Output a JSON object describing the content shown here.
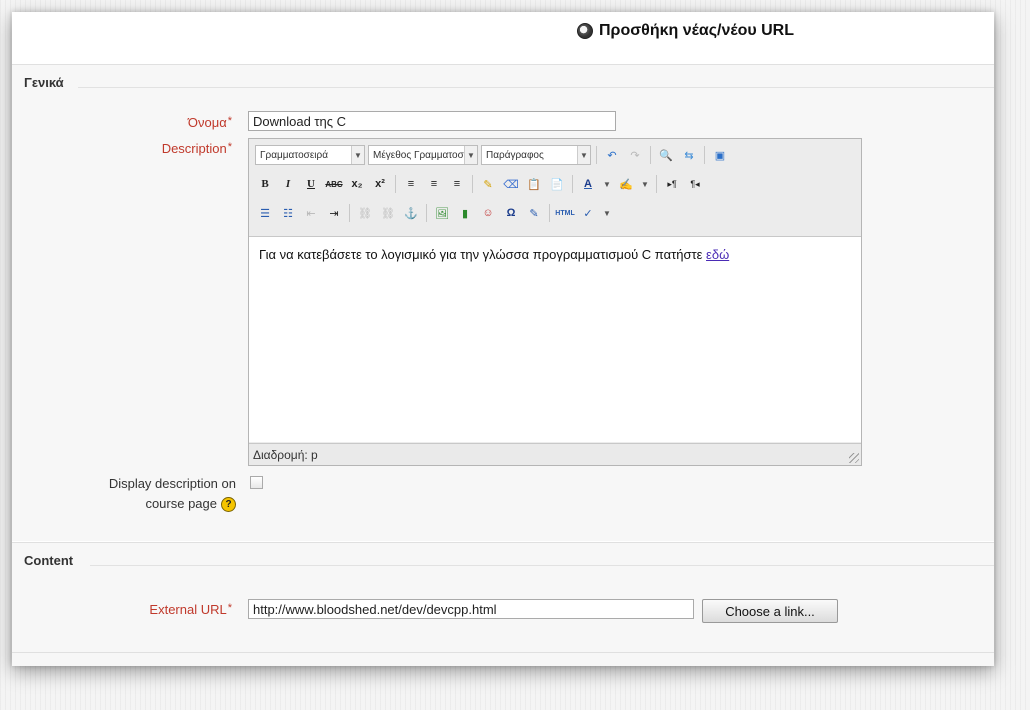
{
  "page": {
    "title": "Προσθήκη νέας/νέου URL",
    "title_icon": "url-resource-icon"
  },
  "general": {
    "legend": "Γενικά",
    "name_label": "Όνομα",
    "name_value": "Download της C",
    "description_label": "Description",
    "required_marker": "*",
    "editor": {
      "font_family": "Γραμματοσειρά",
      "font_size": "Μέγεθος Γραμματοσειράς",
      "paragraph": "Παράγραφος",
      "content_text": "Για να κατεβάσετε το λογισμικό για την γλώσσα προγραμματισμού C πατήστε ",
      "content_link": "εδώ",
      "path": "Διαδρομή: p",
      "toolbar_row2": [
        "B",
        "I",
        "U",
        "ABC",
        "x₂",
        "x²",
        "align-left",
        "align-center",
        "align-right",
        "cleanup",
        "erase",
        "paste-text",
        "paste-word",
        "A",
        "highlight",
        "ltr",
        "rtl"
      ],
      "toolbar_row3": [
        "bullets",
        "numbering",
        "outdent",
        "indent",
        "link",
        "unlink",
        "anchor",
        "image",
        "media",
        "emoticon",
        "Ω",
        "edit",
        "html",
        "spellcheck"
      ]
    },
    "display_description_label_line1": "Display description on",
    "display_description_label_line2": "course page",
    "help_symbol": "?"
  },
  "content": {
    "legend": "Content",
    "external_url_label": "External URL",
    "external_url_value": "http://www.bloodshed.net/dev/devcpp.html",
    "choose_link_button": "Choose a link..."
  },
  "colors": {
    "required": "#c0392b",
    "link": "#4a2bb5",
    "help": "#f5c400"
  }
}
